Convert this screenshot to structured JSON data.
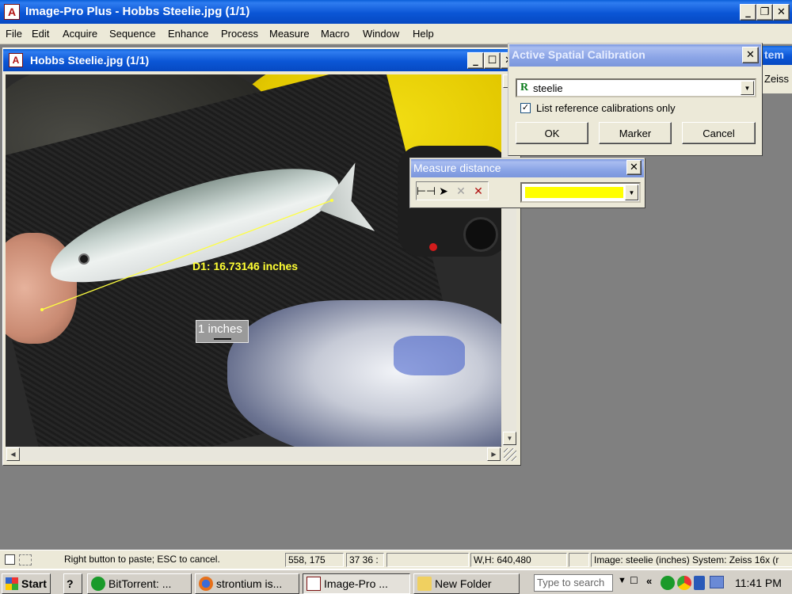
{
  "app": {
    "title": "Image-Pro Plus - Hobbs Steelie.jpg (1/1)"
  },
  "menu": [
    "File",
    "Edit",
    "Acquire",
    "Sequence",
    "Enhance",
    "Process",
    "Measure",
    "Macro",
    "Window",
    "Help"
  ],
  "image_window": {
    "title": "Hobbs Steelie.jpg (1/1)",
    "measurement_label": "D1: 16.73146 inches",
    "scale_bar_label": "1 inches"
  },
  "calibration_dialog": {
    "title": "Active Spatial Calibration",
    "calibration_badge": "R",
    "selected_calibration": "steelie",
    "checkbox_label": "List reference calibrations only",
    "checkbox_checked": true,
    "ok_label": "OK",
    "marker_label": "Marker",
    "cancel_label": "Cancel"
  },
  "background_window": {
    "title_fragment": "tem s",
    "content_fragment": "Zeiss"
  },
  "measure_dialog": {
    "title": "Measure distance",
    "line_color": "#ffff00"
  },
  "status": {
    "hint": "Right button to paste; ESC to cancel.",
    "coords": "558, 175",
    "pixel_value": "37  36 :",
    "dimensions": "W,H: 640,480",
    "calibration_info": "Image: steelie (inches) System: Zeiss 16x (r"
  },
  "taskbar": {
    "start_label": "Start",
    "tasks": [
      {
        "label": "BitTorrent: ..."
      },
      {
        "label": "strontium is..."
      },
      {
        "label": "Image-Pro ..."
      },
      {
        "label": "New Folder"
      }
    ],
    "search_placeholder": "Type to search",
    "clock": "11:41 PM"
  },
  "colors": {
    "measure_overlay": "#ffff33",
    "title_active": "#0b56d6",
    "title_inactive": "#8aa4e6"
  }
}
